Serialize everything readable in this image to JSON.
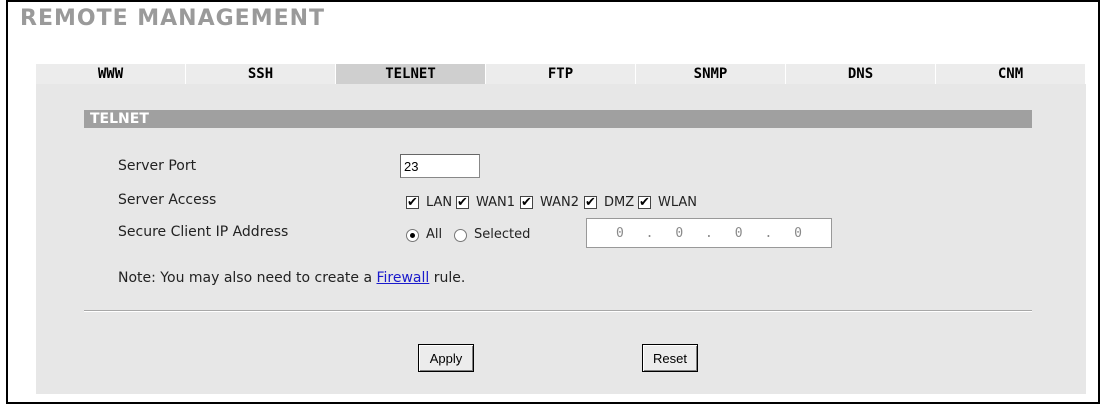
{
  "page": {
    "title": "REMOTE MANAGEMENT"
  },
  "tabs": [
    {
      "label": "WWW"
    },
    {
      "label": "SSH"
    },
    {
      "label": "TELNET",
      "active": true
    },
    {
      "label": "FTP"
    },
    {
      "label": "SNMP"
    },
    {
      "label": "DNS"
    },
    {
      "label": "CNM"
    }
  ],
  "section": {
    "title": "TELNET"
  },
  "form": {
    "server_port": {
      "label": "Server Port",
      "value": "23"
    },
    "server_access": {
      "label": "Server Access",
      "options": [
        {
          "label": "LAN",
          "checked": true
        },
        {
          "label": "WAN1",
          "checked": true
        },
        {
          "label": "WAN2",
          "checked": true
        },
        {
          "label": "DMZ",
          "checked": true
        },
        {
          "label": "WLAN",
          "checked": true
        }
      ]
    },
    "secure_client": {
      "label": "Secure Client IP Address",
      "options": [
        {
          "label": "All",
          "selected": true
        },
        {
          "label": "Selected",
          "selected": false
        }
      ],
      "ip": [
        "0",
        "0",
        "0",
        "0"
      ]
    }
  },
  "note": {
    "prefix": "Note: You may also need to create a ",
    "link": "Firewall",
    "suffix": " rule."
  },
  "buttons": {
    "apply": "Apply",
    "reset": "Reset"
  }
}
